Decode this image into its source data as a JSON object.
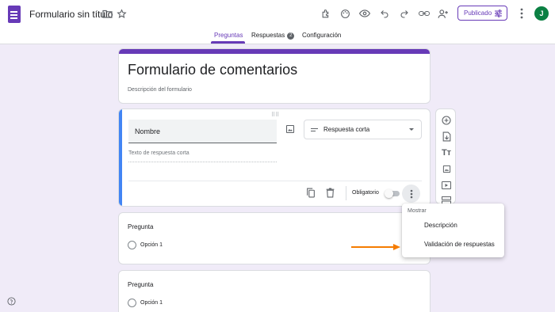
{
  "app": {
    "doc_title": "Formulario sin título",
    "publish_label": "Publicado",
    "avatar_initial": "J",
    "accent_color": "#673ab7"
  },
  "tabs": [
    {
      "label": "Preguntas",
      "active": true
    },
    {
      "label": "Respuestas",
      "badge": "2"
    },
    {
      "label": "Configuración"
    }
  ],
  "form": {
    "title": "Formulario de comentarios",
    "description": "Descripción del formulario"
  },
  "question": {
    "text": "Nombre",
    "type_label": "Respuesta corta",
    "answer_placeholder": "Texto de respuesta corta",
    "required_label": "Obligatorio",
    "required": false
  },
  "other_questions": [
    {
      "label": "Pregunta",
      "option": "Opción 1"
    },
    {
      "label": "Pregunta",
      "option": "Opción 1"
    }
  ],
  "menu": {
    "heading": "Mostrar",
    "items": [
      "Descripción",
      "Validación de respuestas"
    ]
  },
  "icons": [
    "folder-icon",
    "star-icon",
    "addon-icon",
    "palette-icon",
    "preview-icon",
    "undo-icon",
    "redo-icon",
    "link-icon",
    "add-collaborator-icon",
    "more-vert-icon",
    "add-question-icon",
    "import-questions-icon",
    "add-title-icon",
    "add-image-icon",
    "add-video-icon",
    "add-section-icon",
    "copy-icon",
    "trash-icon",
    "help-icon"
  ]
}
